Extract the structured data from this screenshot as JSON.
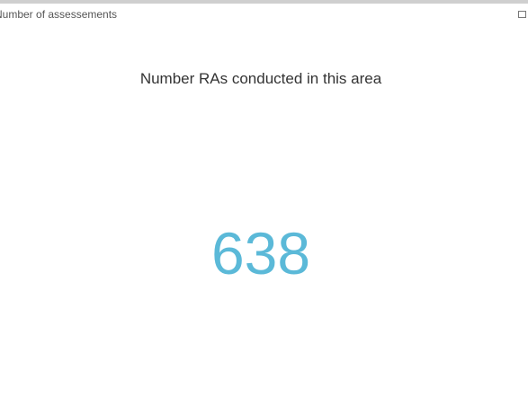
{
  "widget": {
    "title": "Number of assessements",
    "maximize_icon": "maximize-icon",
    "subtitle": "Number RAs conducted in this area",
    "value": "638",
    "value_color": "#5bb9d8"
  }
}
